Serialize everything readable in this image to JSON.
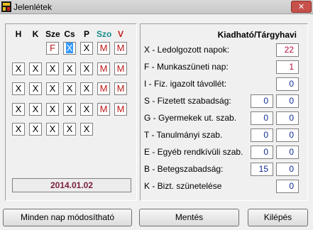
{
  "window": {
    "title": "Jelenlétek",
    "close_glyph": "✕"
  },
  "calendar": {
    "headers": [
      {
        "label": "H",
        "color": "#000000"
      },
      {
        "label": "K",
        "color": "#000000"
      },
      {
        "label": "Sze",
        "color": "#000000"
      },
      {
        "label": "Cs",
        "color": "#000000"
      },
      {
        "label": "P",
        "color": "#000000"
      },
      {
        "label": "Szo",
        "color": "#1a8a8a"
      },
      {
        "label": "V",
        "color": "#cc2020"
      }
    ],
    "rows": [
      [
        null,
        null,
        "F",
        "X",
        "X",
        "M",
        "M"
      ],
      [
        "X",
        "X",
        "X",
        "X",
        "X",
        "M",
        "M"
      ],
      [
        "X",
        "X",
        "X",
        "X",
        "X",
        "M",
        "M"
      ],
      [
        "X",
        "X",
        "X",
        "X",
        "X",
        "M",
        "M"
      ],
      [
        "X",
        "X",
        "X",
        "X",
        "X",
        null,
        null
      ]
    ],
    "selected_cell": {
      "row": 0,
      "col": 3
    },
    "date": "2014.01.02"
  },
  "summary": {
    "header": "Kiadható/Tárgyhavi",
    "rows": [
      {
        "label": "X - Ledolgozott napok:",
        "available": null,
        "monthly": "22"
      },
      {
        "label": "F - Munkaszüneti nap:",
        "available": null,
        "monthly": "1"
      },
      {
        "label": "I - Fiz. igazolt távollét:",
        "available": null,
        "monthly": "0"
      },
      {
        "label": "S - Fizetett szabadság:",
        "available": "0",
        "monthly": "0"
      },
      {
        "label": "G - Gyermekek ut. szab.",
        "available": "0",
        "monthly": "0"
      },
      {
        "label": "T - Tanulmányi szab.",
        "available": "0",
        "monthly": "0"
      },
      {
        "label": "E - Egyéb rendkívüli szab.",
        "available": "0",
        "monthly": "0"
      },
      {
        "label": "B - Betegszabadság:",
        "available": "15",
        "monthly": "0"
      },
      {
        "label": "K - Bizt. szünetelése",
        "available": null,
        "monthly": "0"
      }
    ]
  },
  "buttons": {
    "all_days": "Minden nap módosítható",
    "save": "Mentés",
    "exit": "Kilépés"
  },
  "colors": {
    "red_text": "#c01818",
    "value_red": "#b0103a",
    "value_blue": "#102a90"
  }
}
